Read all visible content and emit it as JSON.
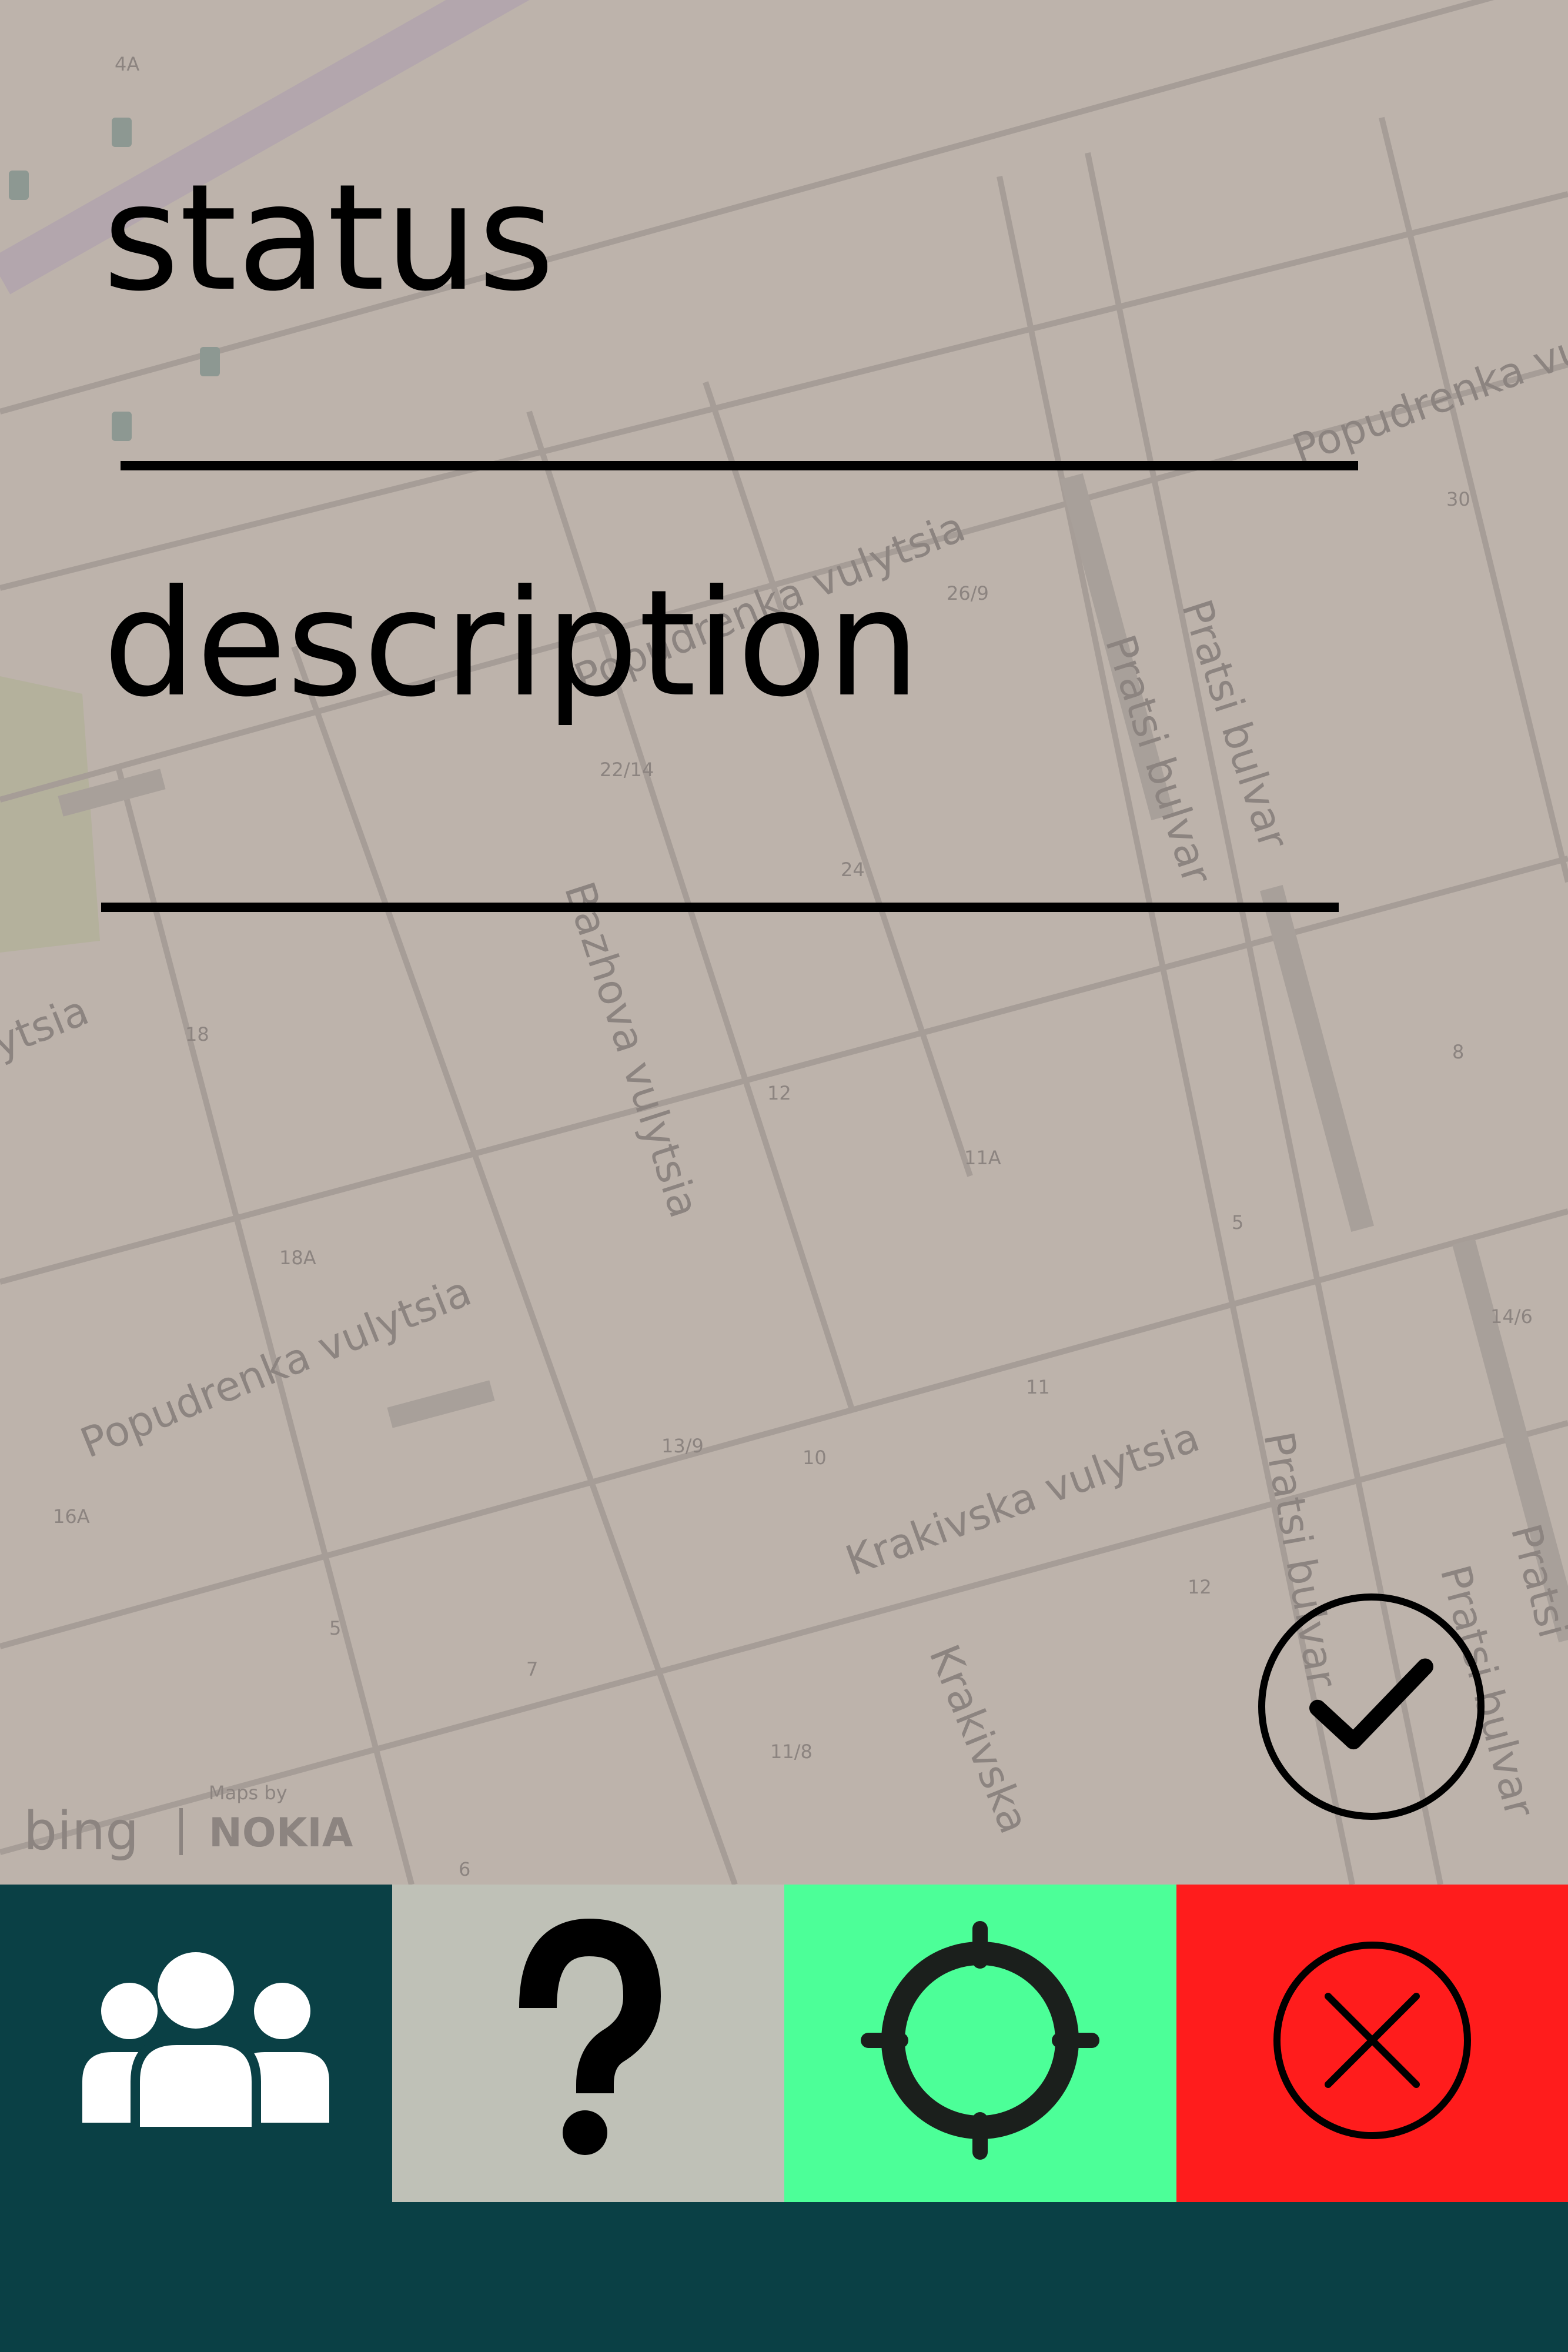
{
  "colors": {
    "map_background": "#bdb3ab",
    "map_lines": "#a69d97",
    "map_label": "#8c8480",
    "text": "#000000",
    "toolbar_dark": "#0a4045",
    "help_button_bg": "#bfc1b7",
    "locate_button_bg": "#4cff98",
    "cancel_button_bg": "#ff1c1c"
  },
  "form": {
    "status_label": "status",
    "description_label": "description"
  },
  "map": {
    "street_labels": [
      "Popudrenka vulytsia",
      "Popudrenka vulytsia",
      "Popudrenka vul",
      "Pratsi bulvar",
      "Pratsi bulvar",
      "Bazhova vulytsia",
      "Krakivska vulytsia",
      "Krakivska",
      "Pratsi bulvar",
      "Pratsi bulvar",
      "Pratsi",
      "ytsia"
    ],
    "house_numbers": [
      "4A",
      "26/9",
      "30",
      "22/14",
      "24",
      "18",
      "12",
      "11A",
      "8",
      "5",
      "14/6",
      "18A",
      "13/9",
      "10",
      "11",
      "16A",
      "12",
      "11/8",
      "7",
      "5",
      "6"
    ],
    "attribution": {
      "bing": "bing",
      "maps_by": "Maps by",
      "nokia": "NOKIA"
    }
  },
  "toolbar": {
    "buttons": [
      {
        "name": "people",
        "icon": "people-group-icon"
      },
      {
        "name": "help",
        "icon": "question-mark-icon"
      },
      {
        "name": "locate",
        "icon": "crosshair-icon"
      },
      {
        "name": "cancel",
        "icon": "close-circle-icon"
      }
    ],
    "confirm_icon": "checkmark-circle-icon"
  }
}
